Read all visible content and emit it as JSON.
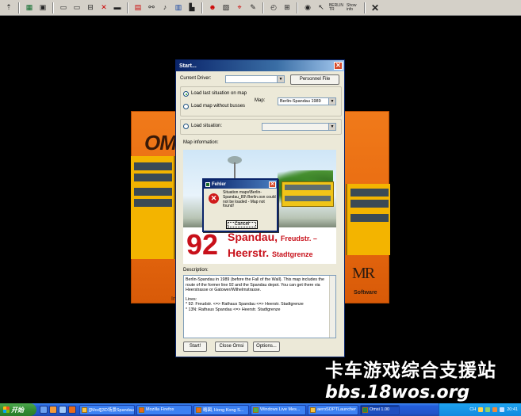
{
  "toolbar": {
    "buttons": [
      "arrow-up",
      "map",
      "save",
      "bus",
      "bus",
      "bus-stop",
      "delete",
      "bus-edit",
      "camera",
      "connect",
      "sound",
      "bus",
      "lock",
      "driver",
      "schedule",
      "pin",
      "brush",
      "clock",
      "timetable",
      "eye",
      "cursor",
      "radio",
      "timetable",
      "close"
    ],
    "radio_label": "BERLIN TR",
    "info_label": "Show info"
  },
  "splash": {
    "logo": "OMI",
    "tagline": "In",
    "mr": "MR",
    "software": "Software"
  },
  "start_dialog": {
    "title": "Start...",
    "current_driver_label": "Current Driver:",
    "current_driver_value": "",
    "personnel_file_button": "Personnel File",
    "load_last_label": "Load last situation on map",
    "load_without_buses_label": "Load map without busses",
    "map_label": "Map:",
    "map_value": "Berlin-Spandau 1989",
    "load_situation_label": "Load situation:",
    "load_situation_value": "",
    "map_information_label": "Map information:",
    "route_number": "92",
    "route_line1": "Spandau,",
    "route_line1_small": "Freudstr. –",
    "route_line2": "Heerstr.",
    "route_line2_small": "Stadtgrenze",
    "description_label": "Description:",
    "description_paragraphs": [
      "Berlin-Spandau in 1989 (before the Fall of the Wall). This map includes the route of the former line 92 and the Spandau depot. You can get there via Heerstrasse or Gatower/Wilhelmstrasse.",
      "Lines:",
      "* 92: Freudstr. <=> Rathaus Spandau <=> Heerstr. Stadtgrenze",
      "* 13N: Rathaus Spandau <=> Heerstr. Stadtgrenze"
    ],
    "start_button": "Start!",
    "close_button": "Close Omsi",
    "options_button": "Options..."
  },
  "error_dialog": {
    "title": "Fehler",
    "message": "Situation maps\\Berlin-Spandau_89\\  Berlin.osn could not be loaded - Map not found!",
    "cancel_button": "Cancel"
  },
  "watermark": {
    "line1": "卡车游戏综合支援站",
    "line2": "bbs.18wos.org"
  },
  "taskbar": {
    "start_label": "开始",
    "tasks": [
      {
        "label": "[[Mod]]3D场景Spandau..."
      },
      {
        "label": "Mozilla Firefox"
      },
      {
        "label": "略図, Hong Kong S..."
      },
      {
        "label": "Windows Live Mes..."
      },
      {
        "label": "aeroSOPTLauncher"
      },
      {
        "label": "Omsi 1.00"
      }
    ],
    "tray_lang": "CH",
    "time": "20:41"
  }
}
